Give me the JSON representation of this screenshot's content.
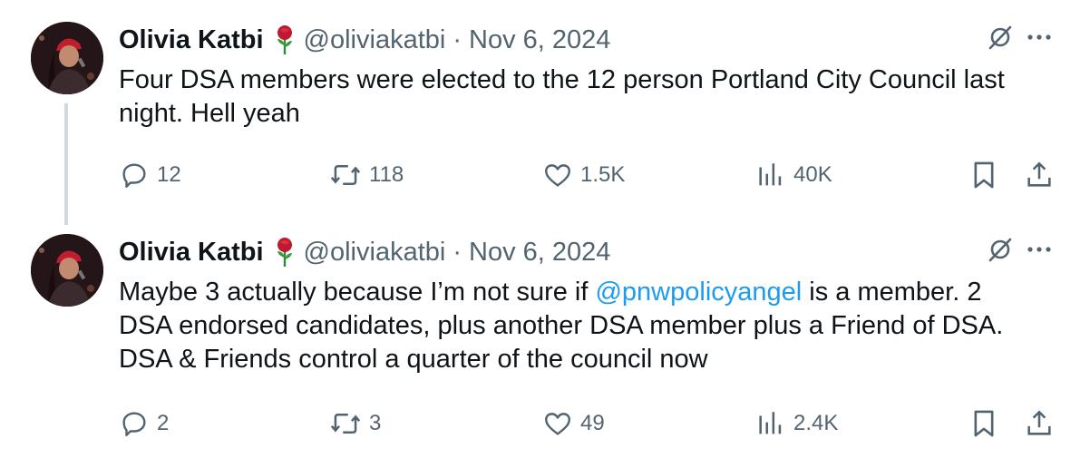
{
  "tweets": [
    {
      "author_name": "Olivia Katbi",
      "handle": "@oliviakatbi",
      "separator": "·",
      "date": "Nov 6, 2024",
      "text_lines": [
        "Four DSA members were elected to the 12 person Portland City Council last",
        "night. Hell yeah"
      ],
      "stats": {
        "replies": "12",
        "reposts": "118",
        "likes": "1.5K",
        "views": "40K"
      }
    },
    {
      "author_name": "Olivia Katbi",
      "handle": "@oliviakatbi",
      "separator": "·",
      "date": "Nov 6, 2024",
      "text_line1_before": "Maybe 3 actually because I’m not sure if ",
      "mention": "@pnwpolicyangel",
      "text_line1_after": " is a member. 2",
      "text_lines_rest": [
        "DSA endorsed candidates, plus another DSA member plus a Friend of DSA.",
        "DSA & Friends control a quarter of the council now"
      ],
      "stats": {
        "replies": "2",
        "reposts": "3",
        "likes": "49",
        "views": "2.4K"
      }
    }
  ],
  "icons": [
    "rose-emoji-icon",
    "grok-icon",
    "more-icon",
    "reply-icon",
    "repost-icon",
    "like-icon",
    "views-icon",
    "bookmark-icon",
    "share-icon"
  ],
  "colors": {
    "text": "#0f1419",
    "secondary": "#536471",
    "link": "#1d9bf0",
    "thread_line": "#cfd9de"
  }
}
